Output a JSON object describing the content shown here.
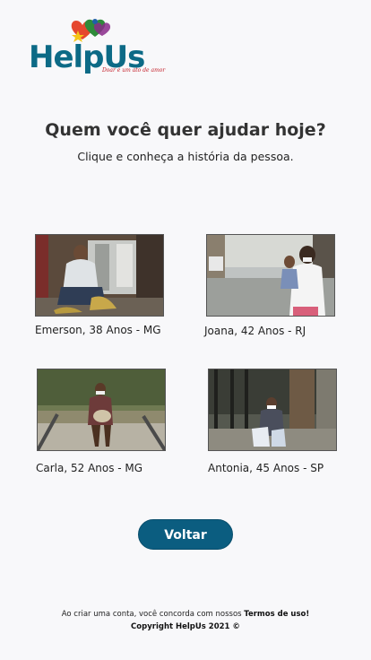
{
  "brand": {
    "name": "HelpUs",
    "tagline": "Doar é um ato de amor",
    "colors": {
      "primary": "#0c6a86",
      "accent": "#c4202a",
      "button": "#0b5d80"
    }
  },
  "header": {
    "title": "Quem você quer ajudar hoje?",
    "subtitle": "Clique e conheça a história da pessoa."
  },
  "people": [
    {
      "caption": "Emerson, 38 Anos - MG"
    },
    {
      "caption": "Joana, 42 Anos - RJ"
    },
    {
      "caption": "Carla, 52 Anos - MG"
    },
    {
      "caption": "Antonia, 45 Anos - SP"
    }
  ],
  "actions": {
    "back_label": "Voltar"
  },
  "footer": {
    "terms_prefix": "Ao criar uma conta, você concorda com nossos",
    "terms_link": "Termos de uso!",
    "copyright": "Copyright HelpUs 2021 ©"
  }
}
